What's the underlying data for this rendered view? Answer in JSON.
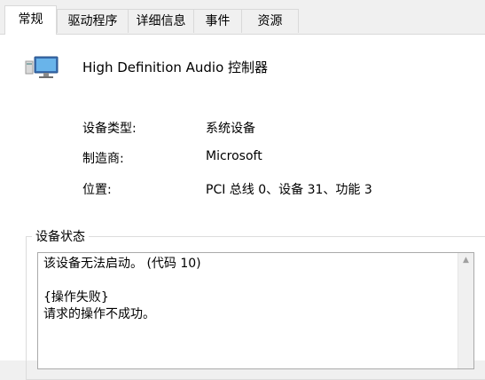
{
  "tabs": [
    {
      "label": "常规",
      "active": true
    },
    {
      "label": "驱动程序"
    },
    {
      "label": "详细信息"
    },
    {
      "label": "事件"
    },
    {
      "label": "资源"
    }
  ],
  "device": {
    "title": "High Definition Audio 控制器",
    "icon": "device-manager-audio-controller-icon"
  },
  "properties": [
    {
      "label": "设备类型:",
      "value": "系统设备"
    },
    {
      "label": "制造商:",
      "value": "Microsoft"
    },
    {
      "label": "位置:",
      "value": "PCI 总线 0、设备 31、功能 3"
    }
  ],
  "status": {
    "group_title": "设备状态",
    "lines": [
      "该设备无法启动。 (代码 10)",
      "",
      "{操作失败}",
      "请求的操作不成功。"
    ]
  },
  "colors": {
    "panel_bg": "#ffffff",
    "tab_border": "#d9d9d9",
    "status_border": "#aaaaaa"
  }
}
